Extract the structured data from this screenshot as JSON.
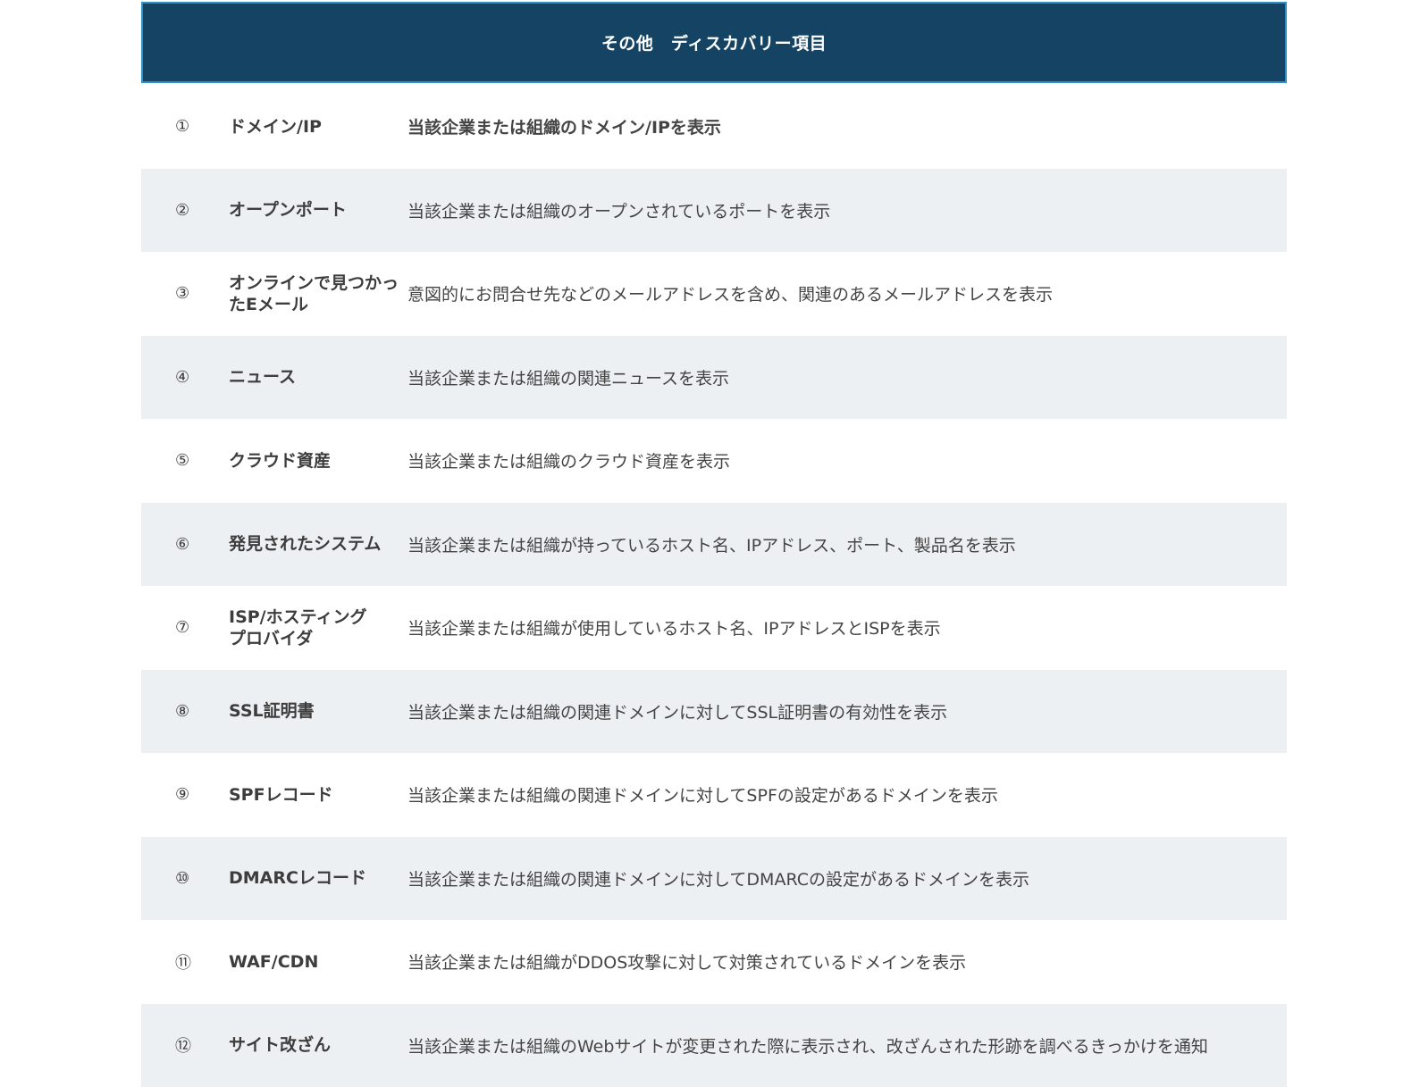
{
  "header": {
    "title": "その他　ディスカバリー項目"
  },
  "rows": [
    {
      "num": "①",
      "name": "ドメイン/IP",
      "desc": "当該企業または組織のドメイン/IPを表示",
      "bold": true
    },
    {
      "num": "②",
      "name": "オープンポート",
      "desc": "当該企業または組織のオープンされているポートを表示"
    },
    {
      "num": "③",
      "name": "オンラインで見つかっ\nたEメール",
      "desc": "意図的にお問合せ先などのメールアドレスを含め、関連のあるメールアドレスを表示"
    },
    {
      "num": "④",
      "name": "ニュース",
      "desc": "当該企業または組織の関連ニュースを表示"
    },
    {
      "num": "⑤",
      "name": "クラウド資産",
      "desc": "当該企業または組織のクラウド資産を表示"
    },
    {
      "num": "⑥",
      "name": "発見されたシステム",
      "desc": "当該企業または組織が持っているホスト名、IPアドレス、ポート、製品名を表示"
    },
    {
      "num": "⑦",
      "name": "ISP/ホスティング\nプロバイダ",
      "desc": "当該企業または組織が使用しているホスト名、IPアドレスとISPを表示"
    },
    {
      "num": "⑧",
      "name": "SSL証明書",
      "desc": "当該企業または組織の関連ドメインに対してSSL証明書の有効性を表示"
    },
    {
      "num": "⑨",
      "name": "SPFレコード",
      "desc": "当該企業または組織の関連ドメインに対してSPFの設定があるドメインを表示"
    },
    {
      "num": "⑩",
      "name": "DMARCレコード",
      "desc": "当該企業または組織の関連ドメインに対してDMARCの設定があるドメインを表示"
    },
    {
      "num": "⑪",
      "name": "WAF/CDN",
      "desc": "当該企業または組織がDDOS攻撃に対して対策されているドメインを表示"
    },
    {
      "num": "⑫",
      "name": "サイト改ざん",
      "desc": "当該企業または組織のWebサイトが変更された際に表示され、改ざんされた形跡を調べるきっかけを通知"
    }
  ],
  "colors": {
    "header_bg": "#154363",
    "header_border": "#2f8fc6",
    "row_alt_bg": "#edf0f3",
    "text": "#3d3d3d"
  }
}
